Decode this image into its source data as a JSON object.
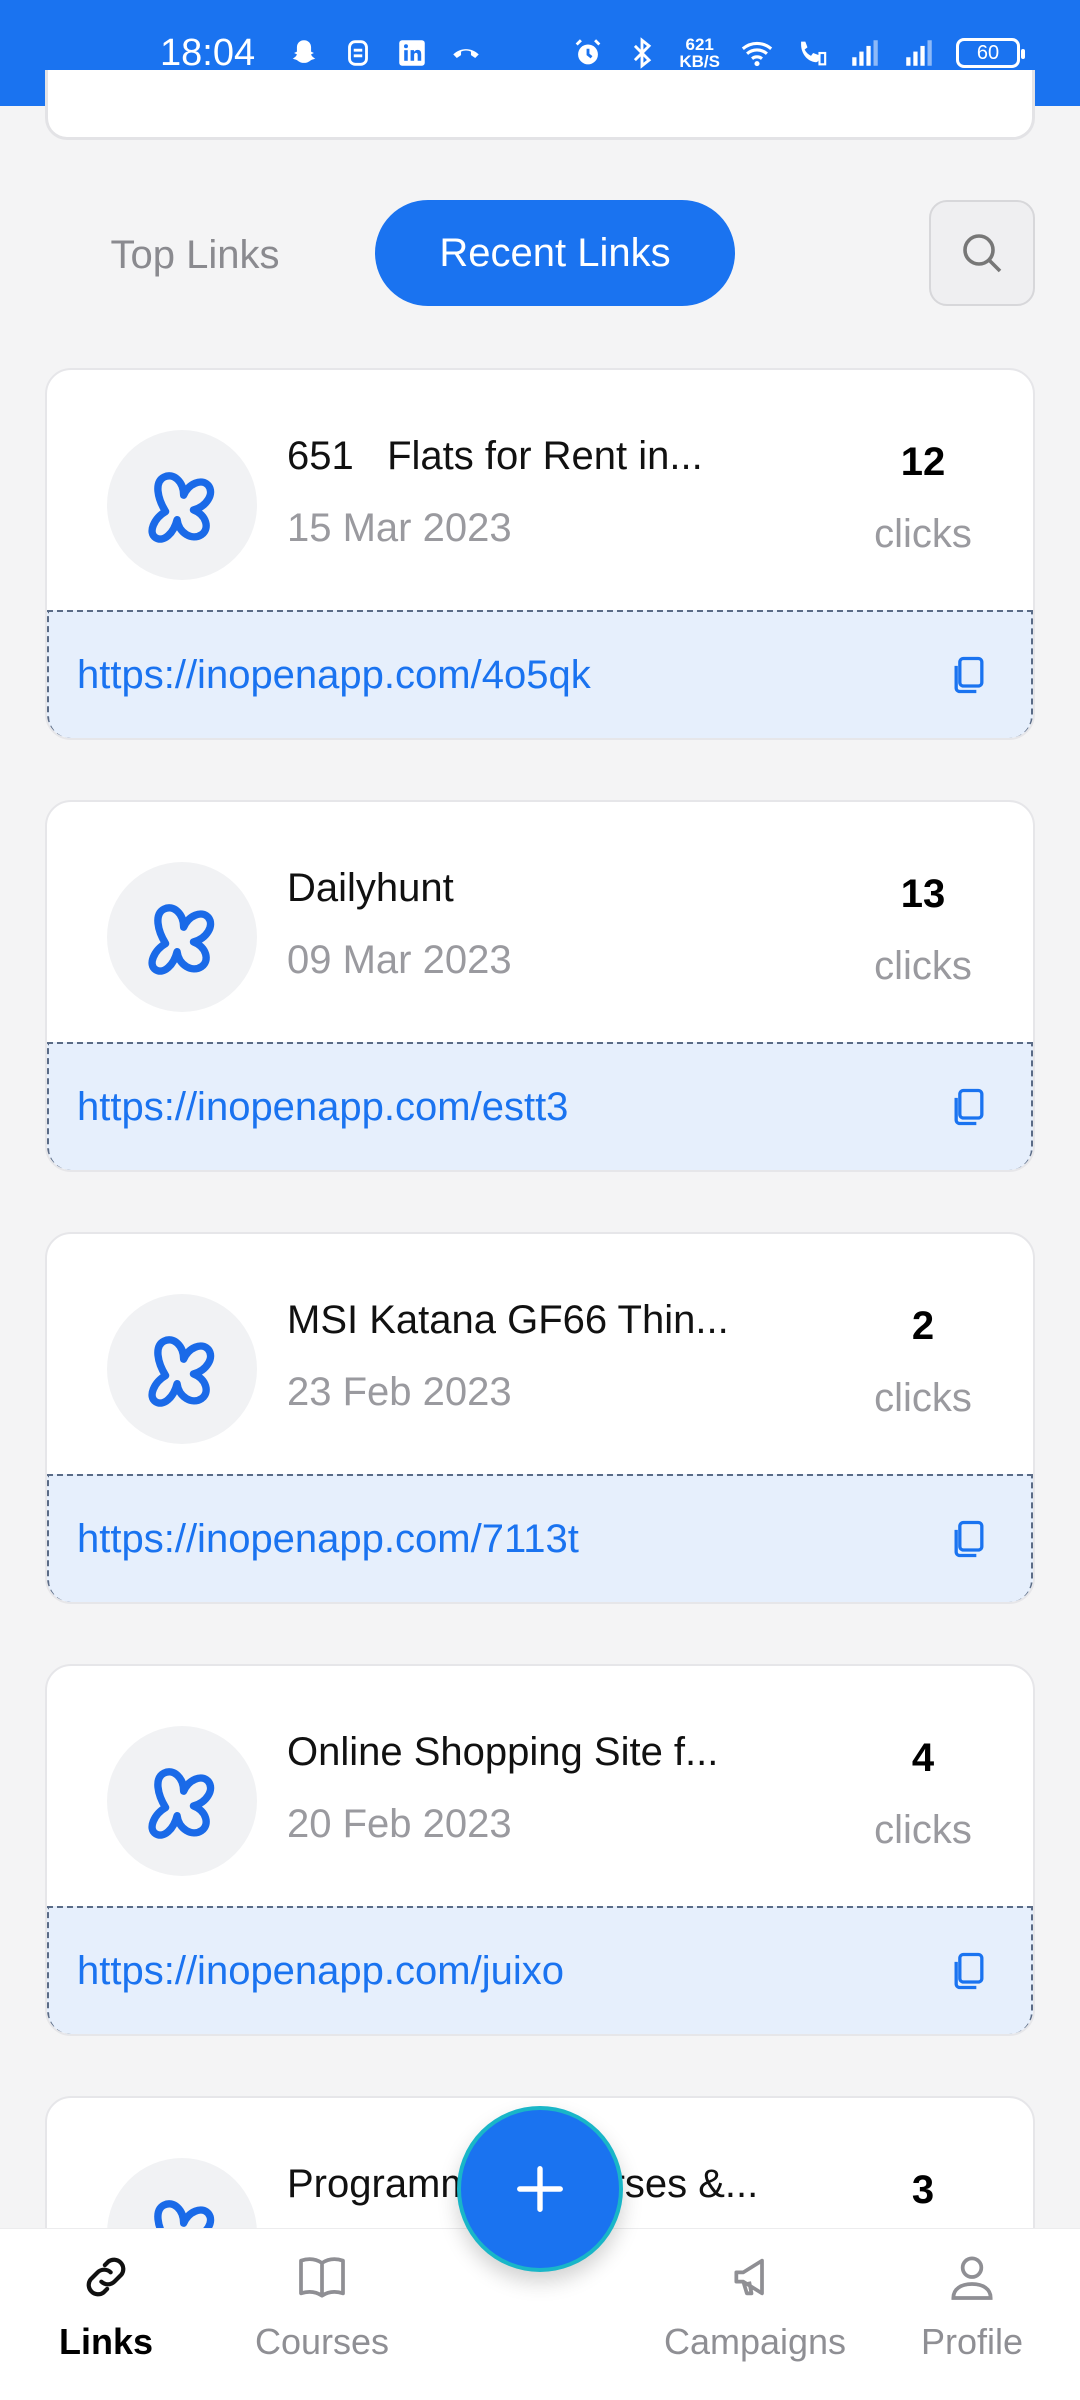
{
  "status_bar": {
    "time": "18:04",
    "net_speed_value": "621",
    "net_speed_unit": "KB/S",
    "battery": "60"
  },
  "tabs": {
    "top_links": "Top Links",
    "recent_links": "Recent Links",
    "search_icon": "search-icon"
  },
  "links": [
    {
      "title": "651   Flats for Rent in...",
      "date": "15 Mar 2023",
      "clicks": "12",
      "clicks_unit": "clicks",
      "url": "https://inopenapp.com/4o5qk"
    },
    {
      "title": "Dailyhunt",
      "date": "09 Mar 2023",
      "clicks": "13",
      "clicks_unit": "clicks",
      "url": "https://inopenapp.com/estt3"
    },
    {
      "title": "MSI Katana GF66 Thin...",
      "date": "23 Feb 2023",
      "clicks": "2",
      "clicks_unit": "clicks",
      "url": "https://inopenapp.com/7113t"
    },
    {
      "title": "Online Shopping Site f...",
      "date": "20 Feb 2023",
      "clicks": "4",
      "clicks_unit": "clicks",
      "url": "https://inopenapp.com/juixo"
    },
    {
      "title": "Programming Courses &...",
      "date": "",
      "clicks": "3",
      "clicks_unit": "clicks",
      "url": ""
    }
  ],
  "bottom_nav": {
    "links": "Links",
    "courses": "Courses",
    "campaigns": "Campaigns",
    "profile": "Profile",
    "add_label": "+"
  },
  "colors": {
    "accent": "#1a73f0",
    "url_bg": "#e6effc"
  }
}
